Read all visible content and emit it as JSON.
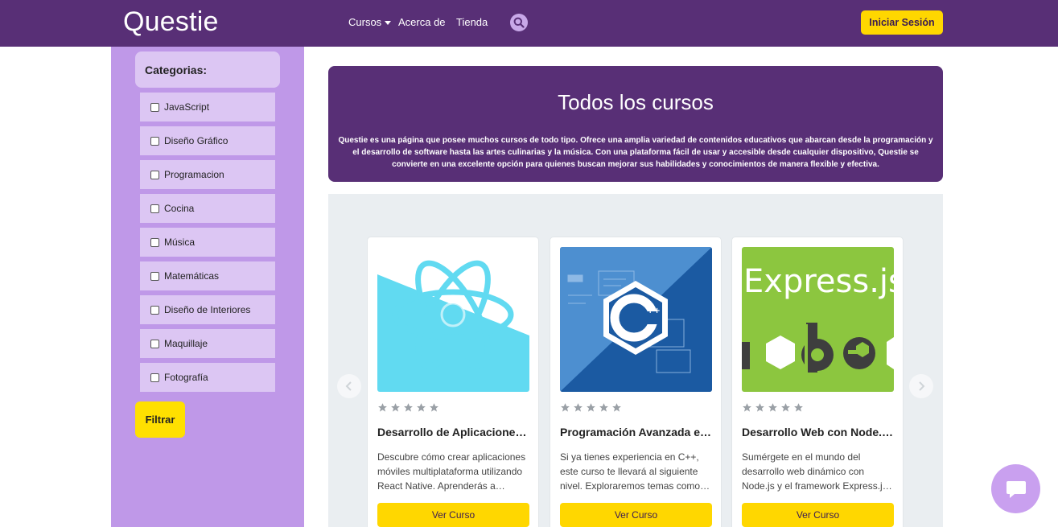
{
  "navbar": {
    "brand": "Questie",
    "links": {
      "cursos": "Cursos",
      "acerca": "Acerca de",
      "tienda": "Tienda"
    },
    "login_label": "Iniciar Sesión",
    "colors": {
      "background": "#582f76",
      "accent": "#ffd700"
    }
  },
  "sidebar": {
    "header": "Categorias:",
    "categories": [
      "JavaScript",
      "Diseño Gráfico",
      "Programacion",
      "Cocina",
      "Música",
      "Matemáticas",
      "Diseño de Interiores",
      "Maquillaje",
      "Fotografía"
    ],
    "filter_label": "Filtrar"
  },
  "hero": {
    "title": "Todos los cursos",
    "description": "Questie es una página que posee muchos cursos de todo tipo. Ofrece una amplia variedad de contenidos educativos que abarcan desde la programación y el desarrollo de software hasta las artes culinarias y la música. Con una plataforma fácil de usar y accesible desde cualquier dispositivo, Questie se convierte en una excelente opción para quienes buscan mejorar sus habilidades y conocimientos de manera flexible y efectiva."
  },
  "courses": [
    {
      "title": "Desarrollo de Aplicaciones Móviles con React Native",
      "description": "Descubre cómo crear aplicaciones móviles multiplataforma utilizando React Native. Aprenderás a desarrollar apps nativas.",
      "button": "Ver Curso",
      "image_icon": "react-logo-icon",
      "rating": 0
    },
    {
      "title": "Programación Avanzada en C++",
      "description": "Si ya tienes experiencia en C++, este curso te llevará al siguiente nivel. Exploraremos temas como plantillas y punteros.",
      "button": "Ver Curso",
      "image_icon": "cpp-logo-icon",
      "rating": 0
    },
    {
      "title": "Desarrollo Web con Node.js y Express",
      "description": "Sumérgete en el mundo del desarrollo web dinámico con Node.js y el framework Express.js y crea servidores.",
      "button": "Ver Curso",
      "image_icon": "express-node-logo-icon",
      "image_text": "Express.js",
      "rating": 0
    }
  ]
}
